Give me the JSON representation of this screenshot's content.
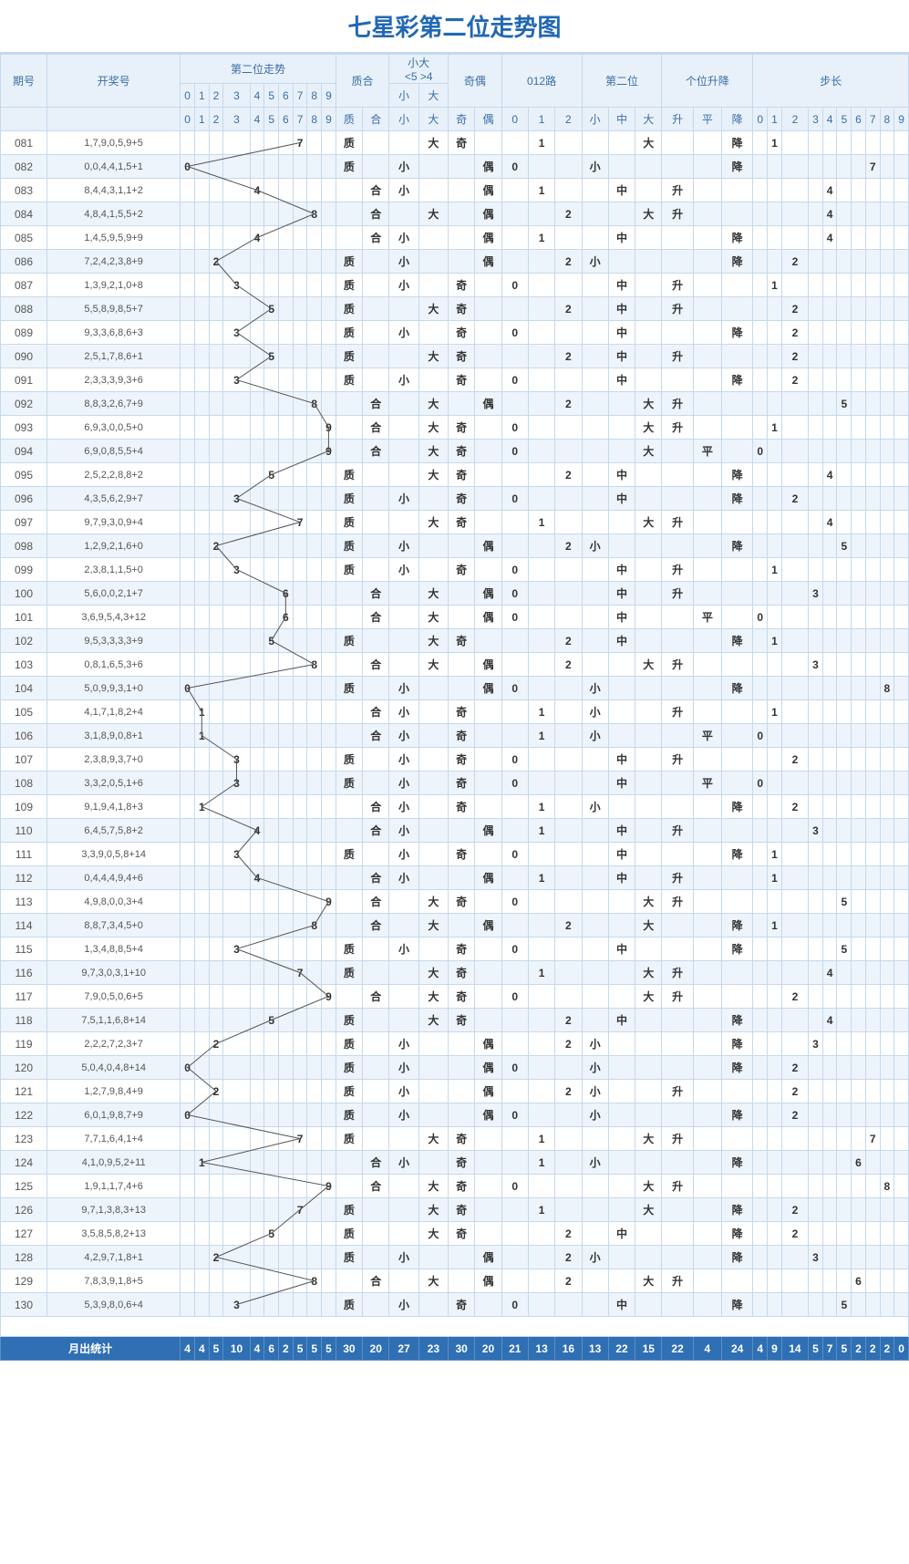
{
  "title": "七星彩第二位走势图",
  "headers": {
    "qihao": "期号",
    "kjh": "开奖号",
    "trend": "第二位走势",
    "trend_digits": [
      "0",
      "1",
      "2",
      "3",
      "4",
      "5",
      "6",
      "7",
      "8",
      "9"
    ],
    "zhihe": "质合",
    "zhihe_sub": [
      "质",
      "合"
    ],
    "xiaoda": "小大",
    "xiaoda_note": "<5  >4",
    "xiaoda_sub": [
      "小",
      "大"
    ],
    "jiou": "奇偶",
    "jiou_sub": [
      "奇",
      "偶"
    ],
    "r012": "012路",
    "r012_sub": [
      "0",
      "1",
      "2"
    ],
    "dzwei": "第二位",
    "dzwei_sub": [
      "小",
      "中",
      "大"
    ],
    "shengjiang": "个位升降",
    "shengjiang_sub": [
      "升",
      "平",
      "降"
    ],
    "buchang": "步长",
    "buchang_digits": [
      "0",
      "1",
      "2",
      "3",
      "4",
      "5",
      "6",
      "7",
      "8",
      "9"
    ]
  },
  "stat_label": "月出统计",
  "chart_data": {
    "type": "table",
    "columns": [
      "期号",
      "开奖号",
      "第二位数字",
      "质合",
      "小大",
      "奇偶",
      "012路",
      "第二位(小中大)",
      "个位升降",
      "步长"
    ],
    "stats": {
      "trend": [
        4,
        4,
        5,
        10,
        4,
        6,
        2,
        5,
        5,
        5
      ],
      "zhihe": [
        30,
        20
      ],
      "xiaoda": [
        27,
        23
      ],
      "jiou": [
        30,
        20
      ],
      "r012": [
        21,
        13,
        16
      ],
      "dzwei": [
        13,
        22,
        15
      ],
      "shengjiang": [
        22,
        4,
        24
      ],
      "buchang": [
        4,
        9,
        14,
        5,
        7,
        5,
        2,
        2,
        2,
        0
      ]
    },
    "rows": [
      {
        "q": "081",
        "k": "1,7,9,0,5,9+5",
        "d": 7,
        "zh": "质",
        "xd": "大",
        "jo": "奇",
        "r": 1,
        "w": "大",
        "sj": "降",
        "b": 1
      },
      {
        "q": "082",
        "k": "0,0,4,4,1,5+1",
        "d": 0,
        "zh": "质",
        "xd": "小",
        "jo": "偶",
        "r": 0,
        "w": "小",
        "sj": "降",
        "b": 7
      },
      {
        "q": "083",
        "k": "8,4,4,3,1,1+2",
        "d": 4,
        "zh": "合",
        "xd": "小",
        "jo": "偶",
        "r": 1,
        "w": "中",
        "sj": "升",
        "b": 4
      },
      {
        "q": "084",
        "k": "4,8,4,1,5,5+2",
        "d": 8,
        "zh": "合",
        "xd": "大",
        "jo": "偶",
        "r": 2,
        "w": "大",
        "sj": "升",
        "b": 4
      },
      {
        "q": "085",
        "k": "1,4,5,9,5,9+9",
        "d": 4,
        "zh": "合",
        "xd": "小",
        "jo": "偶",
        "r": 1,
        "w": "中",
        "sj": "降",
        "b": 4
      },
      {
        "q": "086",
        "k": "7,2,4,2,3,8+9",
        "d": 2,
        "zh": "质",
        "xd": "小",
        "jo": "偶",
        "r": 2,
        "w": "小",
        "sj": "降",
        "b": 2
      },
      {
        "q": "087",
        "k": "1,3,9,2,1,0+8",
        "d": 3,
        "zh": "质",
        "xd": "小",
        "jo": "奇",
        "r": 0,
        "w": "中",
        "sj": "升",
        "b": 1
      },
      {
        "q": "088",
        "k": "5,5,8,9,8,5+7",
        "d": 5,
        "zh": "质",
        "xd": "大",
        "jo": "奇",
        "r": 2,
        "w": "中",
        "sj": "升",
        "b": 2
      },
      {
        "q": "089",
        "k": "9,3,3,6,8,6+3",
        "d": 3,
        "zh": "质",
        "xd": "小",
        "jo": "奇",
        "r": 0,
        "w": "中",
        "sj": "降",
        "b": 2
      },
      {
        "q": "090",
        "k": "2,5,1,7,8,6+1",
        "d": 5,
        "zh": "质",
        "xd": "大",
        "jo": "奇",
        "r": 2,
        "w": "中",
        "sj": "升",
        "b": 2
      },
      {
        "q": "091",
        "k": "2,3,3,3,9,3+6",
        "d": 3,
        "zh": "质",
        "xd": "小",
        "jo": "奇",
        "r": 0,
        "w": "中",
        "sj": "降",
        "b": 2
      },
      {
        "q": "092",
        "k": "8,8,3,2,6,7+9",
        "d": 8,
        "zh": "合",
        "xd": "大",
        "jo": "偶",
        "r": 2,
        "w": "大",
        "sj": "升",
        "b": 5
      },
      {
        "q": "093",
        "k": "6,9,3,0,0,5+0",
        "d": 9,
        "zh": "合",
        "xd": "大",
        "jo": "奇",
        "r": 0,
        "w": "大",
        "sj": "升",
        "b": 1
      },
      {
        "q": "094",
        "k": "6,9,0,8,5,5+4",
        "d": 9,
        "zh": "合",
        "xd": "大",
        "jo": "奇",
        "r": 0,
        "w": "大",
        "sj": "平",
        "b": 0
      },
      {
        "q": "095",
        "k": "2,5,2,2,8,8+2",
        "d": 5,
        "zh": "质",
        "xd": "大",
        "jo": "奇",
        "r": 2,
        "w": "中",
        "sj": "降",
        "b": 4
      },
      {
        "q": "096",
        "k": "4,3,5,6,2,9+7",
        "d": 3,
        "zh": "质",
        "xd": "小",
        "jo": "奇",
        "r": 0,
        "w": "中",
        "sj": "降",
        "b": 2
      },
      {
        "q": "097",
        "k": "9,7,9,3,0,9+4",
        "d": 7,
        "zh": "质",
        "xd": "大",
        "jo": "奇",
        "r": 1,
        "w": "大",
        "sj": "升",
        "b": 4
      },
      {
        "q": "098",
        "k": "1,2,9,2,1,6+0",
        "d": 2,
        "zh": "质",
        "xd": "小",
        "jo": "偶",
        "r": 2,
        "w": "小",
        "sj": "降",
        "b": 5
      },
      {
        "q": "099",
        "k": "2,3,8,1,1,5+0",
        "d": 3,
        "zh": "质",
        "xd": "小",
        "jo": "奇",
        "r": 0,
        "w": "中",
        "sj": "升",
        "b": 1
      },
      {
        "q": "100",
        "k": "5,6,0,0,2,1+7",
        "d": 6,
        "zh": "合",
        "xd": "大",
        "jo": "偶",
        "r": 0,
        "w": "中",
        "sj": "升",
        "b": 3
      },
      {
        "q": "101",
        "k": "3,6,9,5,4,3+12",
        "d": 6,
        "zh": "合",
        "xd": "大",
        "jo": "偶",
        "r": 0,
        "w": "中",
        "sj": "平",
        "b": 0
      },
      {
        "q": "102",
        "k": "9,5,3,3,3,3+9",
        "d": 5,
        "zh": "质",
        "xd": "大",
        "jo": "奇",
        "r": 2,
        "w": "中",
        "sj": "降",
        "b": 1
      },
      {
        "q": "103",
        "k": "0,8,1,6,5,3+6",
        "d": 8,
        "zh": "合",
        "xd": "大",
        "jo": "偶",
        "r": 2,
        "w": "大",
        "sj": "升",
        "b": 3
      },
      {
        "q": "104",
        "k": "5,0,9,9,3,1+0",
        "d": 0,
        "zh": "质",
        "xd": "小",
        "jo": "偶",
        "r": 0,
        "w": "小",
        "sj": "降",
        "b": 8
      },
      {
        "q": "105",
        "k": "4,1,7,1,8,2+4",
        "d": 1,
        "zh": "合",
        "xd": "小",
        "jo": "奇",
        "r": 1,
        "w": "小",
        "sj": "升",
        "b": 1
      },
      {
        "q": "106",
        "k": "3,1,8,9,0,8+1",
        "d": 1,
        "zh": "合",
        "xd": "小",
        "jo": "奇",
        "r": 1,
        "w": "小",
        "sj": "平",
        "b": 0
      },
      {
        "q": "107",
        "k": "2,3,8,9,3,7+0",
        "d": 3,
        "zh": "质",
        "xd": "小",
        "jo": "奇",
        "r": 0,
        "w": "中",
        "sj": "升",
        "b": 2
      },
      {
        "q": "108",
        "k": "3,3,2,0,5,1+6",
        "d": 3,
        "zh": "质",
        "xd": "小",
        "jo": "奇",
        "r": 0,
        "w": "中",
        "sj": "平",
        "b": 0
      },
      {
        "q": "109",
        "k": "9,1,9,4,1,8+3",
        "d": 1,
        "zh": "合",
        "xd": "小",
        "jo": "奇",
        "r": 1,
        "w": "小",
        "sj": "降",
        "b": 2
      },
      {
        "q": "110",
        "k": "6,4,5,7,5,8+2",
        "d": 4,
        "zh": "合",
        "xd": "小",
        "jo": "偶",
        "r": 1,
        "w": "中",
        "sj": "升",
        "b": 3
      },
      {
        "q": "111",
        "k": "3,3,9,0,5,8+14",
        "d": 3,
        "zh": "质",
        "xd": "小",
        "jo": "奇",
        "r": 0,
        "w": "中",
        "sj": "降",
        "b": 1
      },
      {
        "q": "112",
        "k": "0,4,4,4,9,4+6",
        "d": 4,
        "zh": "合",
        "xd": "小",
        "jo": "偶",
        "r": 1,
        "w": "中",
        "sj": "升",
        "b": 1
      },
      {
        "q": "113",
        "k": "4,9,8,0,0,3+4",
        "d": 9,
        "zh": "合",
        "xd": "大",
        "jo": "奇",
        "r": 0,
        "w": "大",
        "sj": "升",
        "b": 5
      },
      {
        "q": "114",
        "k": "8,8,7,3,4,5+0",
        "d": 8,
        "zh": "合",
        "xd": "大",
        "jo": "偶",
        "r": 2,
        "w": "大",
        "sj": "降",
        "b": 1
      },
      {
        "q": "115",
        "k": "1,3,4,8,8,5+4",
        "d": 3,
        "zh": "质",
        "xd": "小",
        "jo": "奇",
        "r": 0,
        "w": "中",
        "sj": "降",
        "b": 5
      },
      {
        "q": "116",
        "k": "9,7,3,0,3,1+10",
        "d": 7,
        "zh": "质",
        "xd": "大",
        "jo": "奇",
        "r": 1,
        "w": "大",
        "sj": "升",
        "b": 4
      },
      {
        "q": "117",
        "k": "7,9,0,5,0,6+5",
        "d": 9,
        "zh": "合",
        "xd": "大",
        "jo": "奇",
        "r": 0,
        "w": "大",
        "sj": "升",
        "b": 2
      },
      {
        "q": "118",
        "k": "7,5,1,1,6,8+14",
        "d": 5,
        "zh": "质",
        "xd": "大",
        "jo": "奇",
        "r": 2,
        "w": "中",
        "sj": "降",
        "b": 4
      },
      {
        "q": "119",
        "k": "2,2,2,7,2,3+7",
        "d": 2,
        "zh": "质",
        "xd": "小",
        "jo": "偶",
        "r": 2,
        "w": "小",
        "sj": "降",
        "b": 3
      },
      {
        "q": "120",
        "k": "5,0,4,0,4,8+14",
        "d": 0,
        "zh": "质",
        "xd": "小",
        "jo": "偶",
        "r": 0,
        "w": "小",
        "sj": "降",
        "b": 2
      },
      {
        "q": "121",
        "k": "1,2,7,9,8,4+9",
        "d": 2,
        "zh": "质",
        "xd": "小",
        "jo": "偶",
        "r": 2,
        "w": "小",
        "sj": "升",
        "b": 2
      },
      {
        "q": "122",
        "k": "6,0,1,9,8,7+9",
        "d": 0,
        "zh": "质",
        "xd": "小",
        "jo": "偶",
        "r": 0,
        "w": "小",
        "sj": "降",
        "b": 2
      },
      {
        "q": "123",
        "k": "7,7,1,6,4,1+4",
        "d": 7,
        "zh": "质",
        "xd": "大",
        "jo": "奇",
        "r": 1,
        "w": "大",
        "sj": "升",
        "b": 7
      },
      {
        "q": "124",
        "k": "4,1,0,9,5,2+11",
        "d": 1,
        "zh": "合",
        "xd": "小",
        "jo": "奇",
        "r": 1,
        "w": "小",
        "sj": "降",
        "b": 6
      },
      {
        "q": "125",
        "k": "1,9,1,1,7,4+6",
        "d": 9,
        "zh": "合",
        "xd": "大",
        "jo": "奇",
        "r": 0,
        "w": "大",
        "sj": "升",
        "b": 8
      },
      {
        "q": "126",
        "k": "9,7,1,3,8,3+13",
        "d": 7,
        "zh": "质",
        "xd": "大",
        "jo": "奇",
        "r": 1,
        "w": "大",
        "sj": "降",
        "b": 2
      },
      {
        "q": "127",
        "k": "3,5,8,5,8,2+13",
        "d": 5,
        "zh": "质",
        "xd": "大",
        "jo": "奇",
        "r": 2,
        "w": "中",
        "sj": "降",
        "b": 2
      },
      {
        "q": "128",
        "k": "4,2,9,7,1,8+1",
        "d": 2,
        "zh": "质",
        "xd": "小",
        "jo": "偶",
        "r": 2,
        "w": "小",
        "sj": "降",
        "b": 3
      },
      {
        "q": "129",
        "k": "7,8,3,9,1,8+5",
        "d": 8,
        "zh": "合",
        "xd": "大",
        "jo": "偶",
        "r": 2,
        "w": "大",
        "sj": "升",
        "b": 6
      },
      {
        "q": "130",
        "k": "5,3,9,8,0,6+4",
        "d": 3,
        "zh": "质",
        "xd": "小",
        "jo": "奇",
        "r": 0,
        "w": "中",
        "sj": "降",
        "b": 5
      }
    ]
  }
}
